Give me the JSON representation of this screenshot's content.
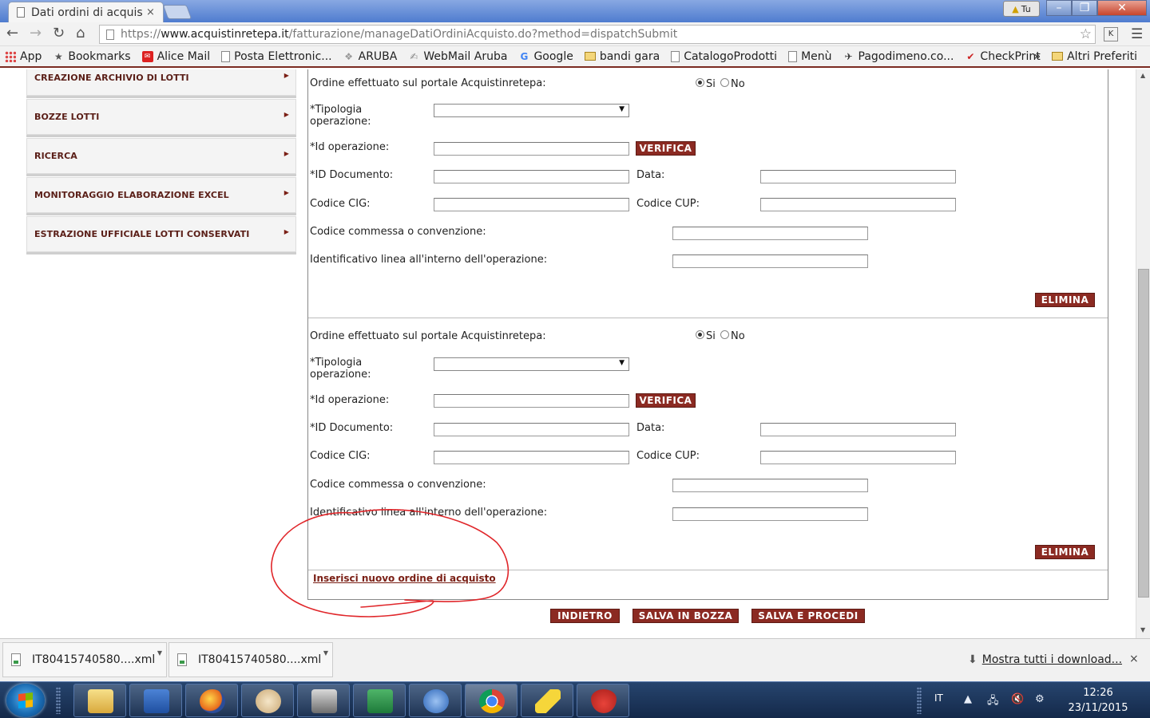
{
  "browser": {
    "tab_title": "Dati ordini di acquist",
    "tab_close": "×",
    "profile_label": "Tu",
    "url_prefix": "https://",
    "url_host": "www.acquistinretepa.it",
    "url_path": "/fatturazione/manageDatiOrdiniAcquisto.do?method=dispatchSubmit",
    "ext_label": "K"
  },
  "bookmarks": {
    "items": [
      "App",
      "Bookmarks",
      "Alice Mail",
      "Posta Elettronic...",
      "ARUBA",
      "WebMail Aruba",
      "Google",
      "bandi gara",
      "CatalogoProdotti",
      "Menù",
      "Pagodimeno.co...",
      "CheckPrint"
    ],
    "more": "»",
    "other": "Altri Preferiti"
  },
  "sidebar": {
    "items": [
      "CREAZIONE ARCHIVIO DI LOTTI",
      "BOZZE LOTTI",
      "RICERCA",
      "MONITORAGGIO ELABORAZIONE EXCEL",
      "ESTRAZIONE UFFICIALE LOTTI CONSERVATI"
    ]
  },
  "form": {
    "portal_question": "Ordine effettuato sul portale Acquistinretepa:",
    "yes_label": "Si",
    "no_label": "No",
    "tipologia_label": "*Tipologia operazione:",
    "id_operazione_label": "*Id operazione:",
    "verifica_button": "VERIFICA",
    "id_documento_label": "*ID Documento:",
    "data_label": "Data:",
    "cig_label": "Codice CIG:",
    "cup_label": "Codice CUP:",
    "commessa_label": "Codice commessa o convenzione:",
    "linea_label": "Identificativo linea all'interno dell'operazione:",
    "elimina_button": "ELIMINA",
    "orders": [
      {
        "portal": "Si",
        "tipologia": "",
        "id_operazione": "",
        "id_documento": "",
        "data": "",
        "cig": "",
        "cup": "",
        "commessa": "",
        "linea": ""
      },
      {
        "portal": "Si",
        "tipologia": "",
        "id_operazione": "",
        "id_documento": "",
        "data": "",
        "cig": "",
        "cup": "",
        "commessa": "",
        "linea": ""
      }
    ],
    "add_order_link": "Inserisci nuovo ordine di acquisto",
    "back_button": "INDIETRO",
    "save_draft_button": "SALVA IN BOZZA",
    "save_proceed_button": "SALVA E PROCEDI"
  },
  "downloads": {
    "items": [
      "IT80415740580....xml",
      "IT80415740580....xml"
    ],
    "show_all": "Mostra tutti i download...",
    "close": "×"
  },
  "taskbar": {
    "language": "IT",
    "time": "12:26",
    "date": "23/11/2015",
    "apps": [
      "explorer",
      "word",
      "firefox",
      "paint",
      "media",
      "excel",
      "app",
      "chrome",
      "highlighter",
      "strawberry"
    ]
  },
  "colors": {
    "accent": "#8b2a22",
    "link": "#7a1f15",
    "annotation": "#e0262a"
  }
}
